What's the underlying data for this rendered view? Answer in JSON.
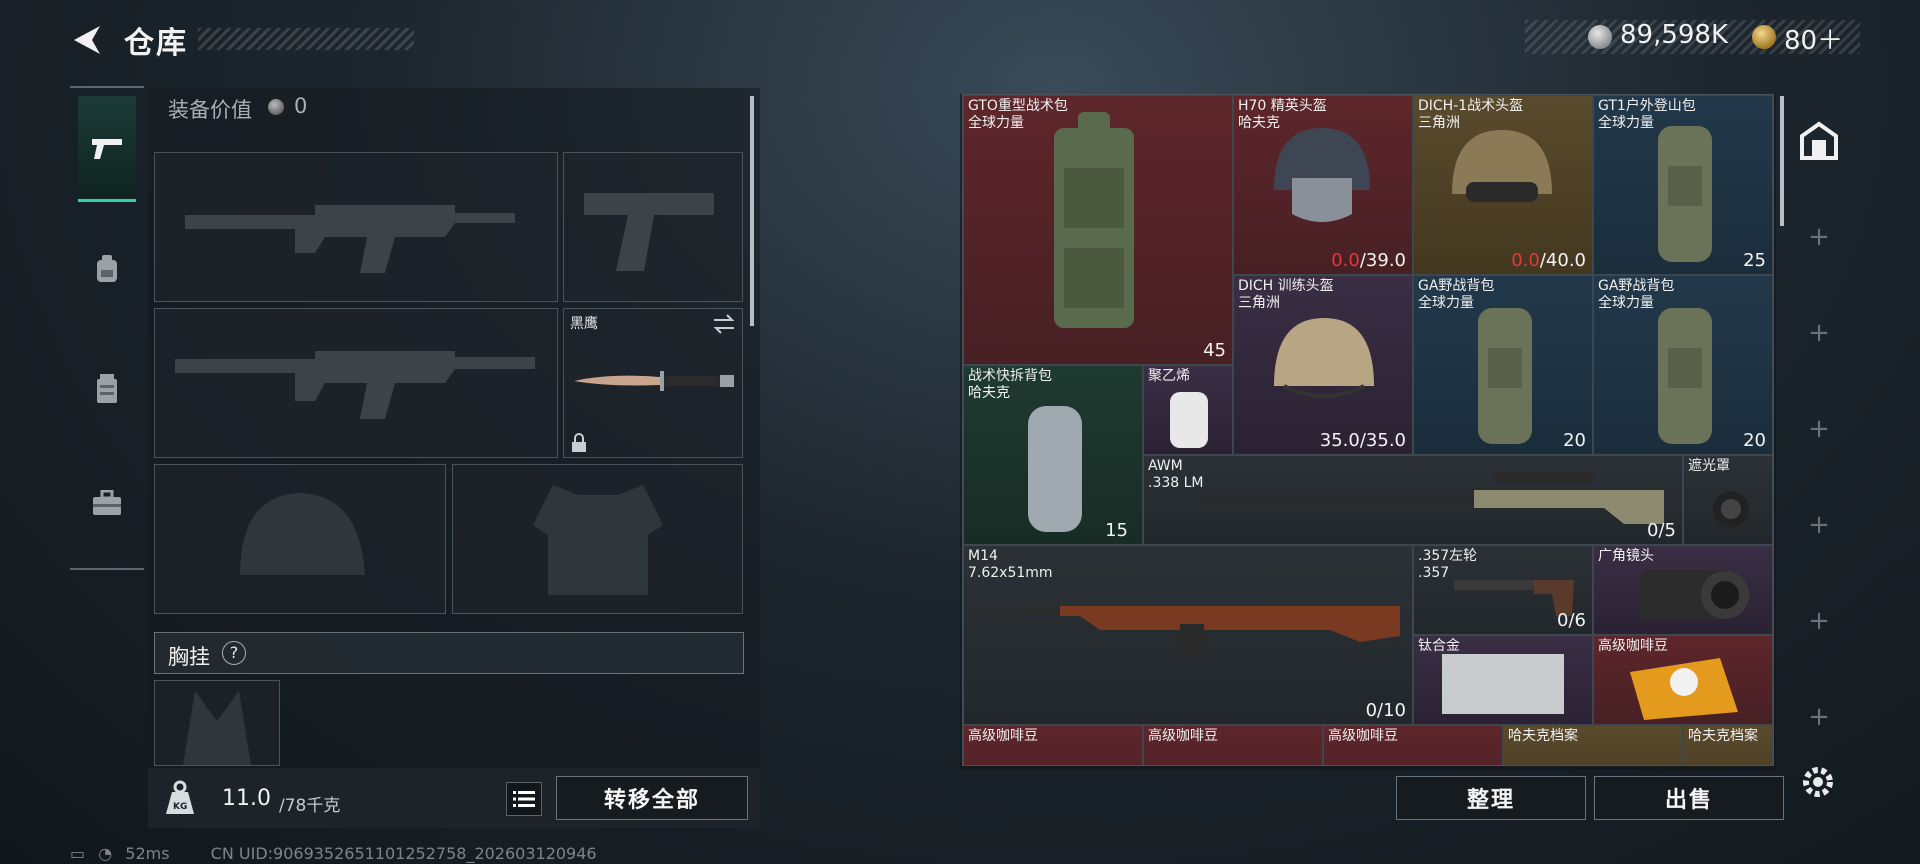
{
  "header": {
    "title": "仓库"
  },
  "currency": [
    {
      "icon": "silver-coin-icon",
      "value": "89,598K"
    },
    {
      "icon": "gold-coin-icon",
      "value": "80＋"
    }
  ],
  "equipment": {
    "value_label": "装备价值",
    "value": "0",
    "secondary_slot_label": "黑鹰",
    "chest_label": "胸挂",
    "chest_help": "?"
  },
  "weight": {
    "current": "11.0",
    "max": "/78千克"
  },
  "buttons": {
    "transfer_all": "转移全部",
    "organize": "整理",
    "sell": "出售"
  },
  "grid_items": [
    {
      "name": "GTO重型战术包",
      "sub": "全球力量",
      "value": "45",
      "tier": "red"
    },
    {
      "name": "H70 精英头盔",
      "sub": "哈夫克",
      "durability": "0.0",
      "durability_max": "/39.0",
      "tier": "red"
    },
    {
      "name": "DICH-1战术头盔",
      "sub": "三角洲",
      "durability": "0.0",
      "durability_max": "/40.0",
      "tier": "gold"
    },
    {
      "name": "GT1户外登山包",
      "sub": "全球力量",
      "value": "25",
      "tier": "blue"
    },
    {
      "name": "DICH 训练头盔",
      "sub": "三角洲",
      "value": "35.0/35.0",
      "tier": "purple"
    },
    {
      "name": "GA野战背包",
      "sub": "全球力量",
      "value": "20",
      "tier": "blue"
    },
    {
      "name": "GA野战背包",
      "sub": "全球力量",
      "value": "20",
      "tier": "blue"
    },
    {
      "name": "战术快拆背包",
      "sub": "哈夫克",
      "value": "15",
      "tier": "green"
    },
    {
      "name": "聚乙烯",
      "sub": "",
      "value": "",
      "tier": "purple"
    },
    {
      "name": "AWM",
      "sub": ".338 LM",
      "value": "0/5",
      "tier": "gray"
    },
    {
      "name": "遮光罩",
      "sub": "",
      "value": "",
      "tier": "gray"
    },
    {
      "name": "M14",
      "sub": "7.62x51mm",
      "value": "0/10",
      "tier": "gray"
    },
    {
      "name": ".357左轮",
      "sub": ".357",
      "value": "0/6",
      "tier": "gray"
    },
    {
      "name": "广角镜头",
      "sub": "",
      "value": "",
      "tier": "purple"
    },
    {
      "name": "钛合金",
      "sub": "",
      "value": "",
      "tier": "purple"
    },
    {
      "name": "高级咖啡豆",
      "sub": "",
      "value": "",
      "tier": "red"
    },
    {
      "name": "高级咖啡豆",
      "sub": "",
      "value": "",
      "tier": "red"
    },
    {
      "name": "高级咖啡豆",
      "sub": "",
      "value": "",
      "tier": "red"
    },
    {
      "name": "高级咖啡豆",
      "sub": "",
      "value": "",
      "tier": "red"
    },
    {
      "name": "哈夫克档案",
      "sub": "",
      "value": "",
      "tier": "gold"
    },
    {
      "name": "哈夫克档案",
      "sub": "",
      "value": "",
      "tier": "gold"
    }
  ],
  "status_bar": {
    "ping": "52ms",
    "uid": "CN UID:9069352651101252758_202603120946"
  },
  "colors": {
    "accent": "#2fd3a8",
    "danger": "#e2393b"
  }
}
